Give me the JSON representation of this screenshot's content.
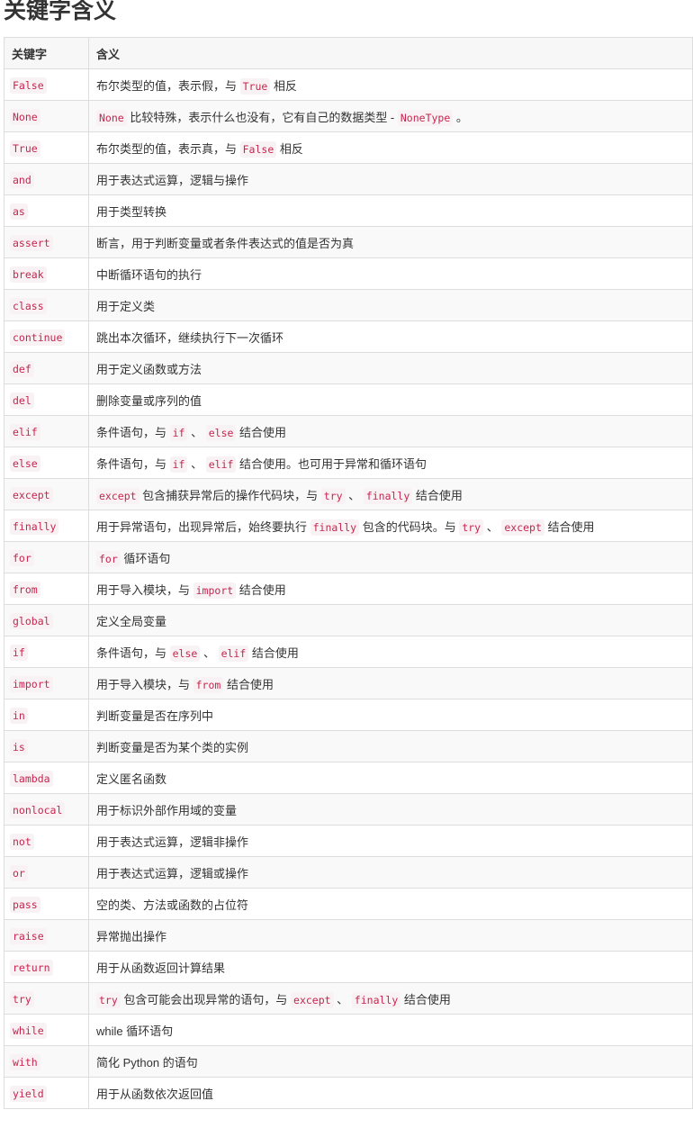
{
  "page": {
    "title": "关键字含义"
  },
  "table": {
    "headers": [
      "关键字",
      "含义"
    ],
    "rows": [
      {
        "keyword": "False",
        "meaning": [
          {
            "t": "布尔类型的值，表示假，与 "
          },
          {
            "c": "True"
          },
          {
            "t": " 相反"
          }
        ]
      },
      {
        "keyword": "None",
        "meaning": [
          {
            "c": "None"
          },
          {
            "t": " 比较特殊，表示什么也没有，它有自己的数据类型 - "
          },
          {
            "c": "NoneType"
          },
          {
            "t": " 。"
          }
        ]
      },
      {
        "keyword": "True",
        "meaning": [
          {
            "t": "布尔类型的值，表示真，与 "
          },
          {
            "c": "False"
          },
          {
            "t": " 相反"
          }
        ]
      },
      {
        "keyword": "and",
        "meaning": [
          {
            "t": "用于表达式运算，逻辑与操作"
          }
        ]
      },
      {
        "keyword": "as",
        "meaning": [
          {
            "t": "用于类型转换"
          }
        ]
      },
      {
        "keyword": "assert",
        "meaning": [
          {
            "t": "断言，用于判断变量或者条件表达式的值是否为真"
          }
        ]
      },
      {
        "keyword": "break",
        "meaning": [
          {
            "t": "中断循环语句的执行"
          }
        ]
      },
      {
        "keyword": "class",
        "meaning": [
          {
            "t": "用于定义类"
          }
        ]
      },
      {
        "keyword": "continue",
        "meaning": [
          {
            "t": "跳出本次循环，继续执行下一次循环"
          }
        ]
      },
      {
        "keyword": "def",
        "meaning": [
          {
            "t": "用于定义函数或方法"
          }
        ]
      },
      {
        "keyword": "del",
        "meaning": [
          {
            "t": "删除变量或序列的值"
          }
        ]
      },
      {
        "keyword": "elif",
        "meaning": [
          {
            "t": "条件语句，与 "
          },
          {
            "c": "if"
          },
          {
            "t": " 、 "
          },
          {
            "c": "else"
          },
          {
            "t": " 结合使用"
          }
        ]
      },
      {
        "keyword": "else",
        "meaning": [
          {
            "t": "条件语句，与 "
          },
          {
            "c": "if"
          },
          {
            "t": " 、 "
          },
          {
            "c": "elif"
          },
          {
            "t": " 结合使用。也可用于异常和循环语句"
          }
        ]
      },
      {
        "keyword": "except",
        "meaning": [
          {
            "c": "except"
          },
          {
            "t": " 包含捕获异常后的操作代码块，与 "
          },
          {
            "c": "try"
          },
          {
            "t": " 、 "
          },
          {
            "c": "finally"
          },
          {
            "t": " 结合使用"
          }
        ]
      },
      {
        "keyword": "finally",
        "meaning": [
          {
            "t": "用于异常语句，出现异常后，始终要执行 "
          },
          {
            "c": "finally"
          },
          {
            "t": " 包含的代码块。与 "
          },
          {
            "c": "try"
          },
          {
            "t": " 、 "
          },
          {
            "c": "except"
          },
          {
            "t": " 结合使用"
          }
        ]
      },
      {
        "keyword": "for",
        "meaning": [
          {
            "c": "for"
          },
          {
            "t": " 循环语句"
          }
        ]
      },
      {
        "keyword": "from",
        "meaning": [
          {
            "t": "用于导入模块，与 "
          },
          {
            "c": "import"
          },
          {
            "t": " 结合使用"
          }
        ]
      },
      {
        "keyword": "global",
        "meaning": [
          {
            "t": "定义全局变量"
          }
        ]
      },
      {
        "keyword": "if",
        "meaning": [
          {
            "t": "条件语句，与 "
          },
          {
            "c": "else"
          },
          {
            "t": " 、 "
          },
          {
            "c": "elif"
          },
          {
            "t": " 结合使用"
          }
        ]
      },
      {
        "keyword": "import",
        "meaning": [
          {
            "t": "用于导入模块，与 "
          },
          {
            "c": "from"
          },
          {
            "t": " 结合使用"
          }
        ]
      },
      {
        "keyword": "in",
        "meaning": [
          {
            "t": "判断变量是否在序列中"
          }
        ]
      },
      {
        "keyword": "is",
        "meaning": [
          {
            "t": "判断变量是否为某个类的实例"
          }
        ]
      },
      {
        "keyword": "lambda",
        "meaning": [
          {
            "t": "定义匿名函数"
          }
        ]
      },
      {
        "keyword": "nonlocal",
        "meaning": [
          {
            "t": "用于标识外部作用域的变量"
          }
        ]
      },
      {
        "keyword": "not",
        "meaning": [
          {
            "t": "用于表达式运算，逻辑非操作"
          }
        ]
      },
      {
        "keyword": "or",
        "meaning": [
          {
            "t": "用于表达式运算，逻辑或操作"
          }
        ]
      },
      {
        "keyword": "pass",
        "meaning": [
          {
            "t": "空的类、方法或函数的占位符"
          }
        ]
      },
      {
        "keyword": "raise",
        "meaning": [
          {
            "t": "异常抛出操作"
          }
        ]
      },
      {
        "keyword": "return",
        "meaning": [
          {
            "t": "用于从函数返回计算结果"
          }
        ]
      },
      {
        "keyword": "try",
        "meaning": [
          {
            "c": "try"
          },
          {
            "t": " 包含可能会出现异常的语句，与 "
          },
          {
            "c": "except"
          },
          {
            "t": " 、 "
          },
          {
            "c": "finally"
          },
          {
            "t": " 结合使用"
          }
        ]
      },
      {
        "keyword": "while",
        "meaning": [
          {
            "t": "while 循环语句"
          }
        ]
      },
      {
        "keyword": "with",
        "meaning": [
          {
            "t": "简化 Python 的语句"
          }
        ]
      },
      {
        "keyword": "yield",
        "meaning": [
          {
            "t": "用于从函数依次返回值"
          }
        ]
      }
    ]
  },
  "colors": {
    "code_text": "#c7254e",
    "code_bg": "#f9f2f4",
    "border": "#dddddd",
    "header_bg": "#f7f7f7",
    "stripe_bg": "#f9f9f9"
  }
}
